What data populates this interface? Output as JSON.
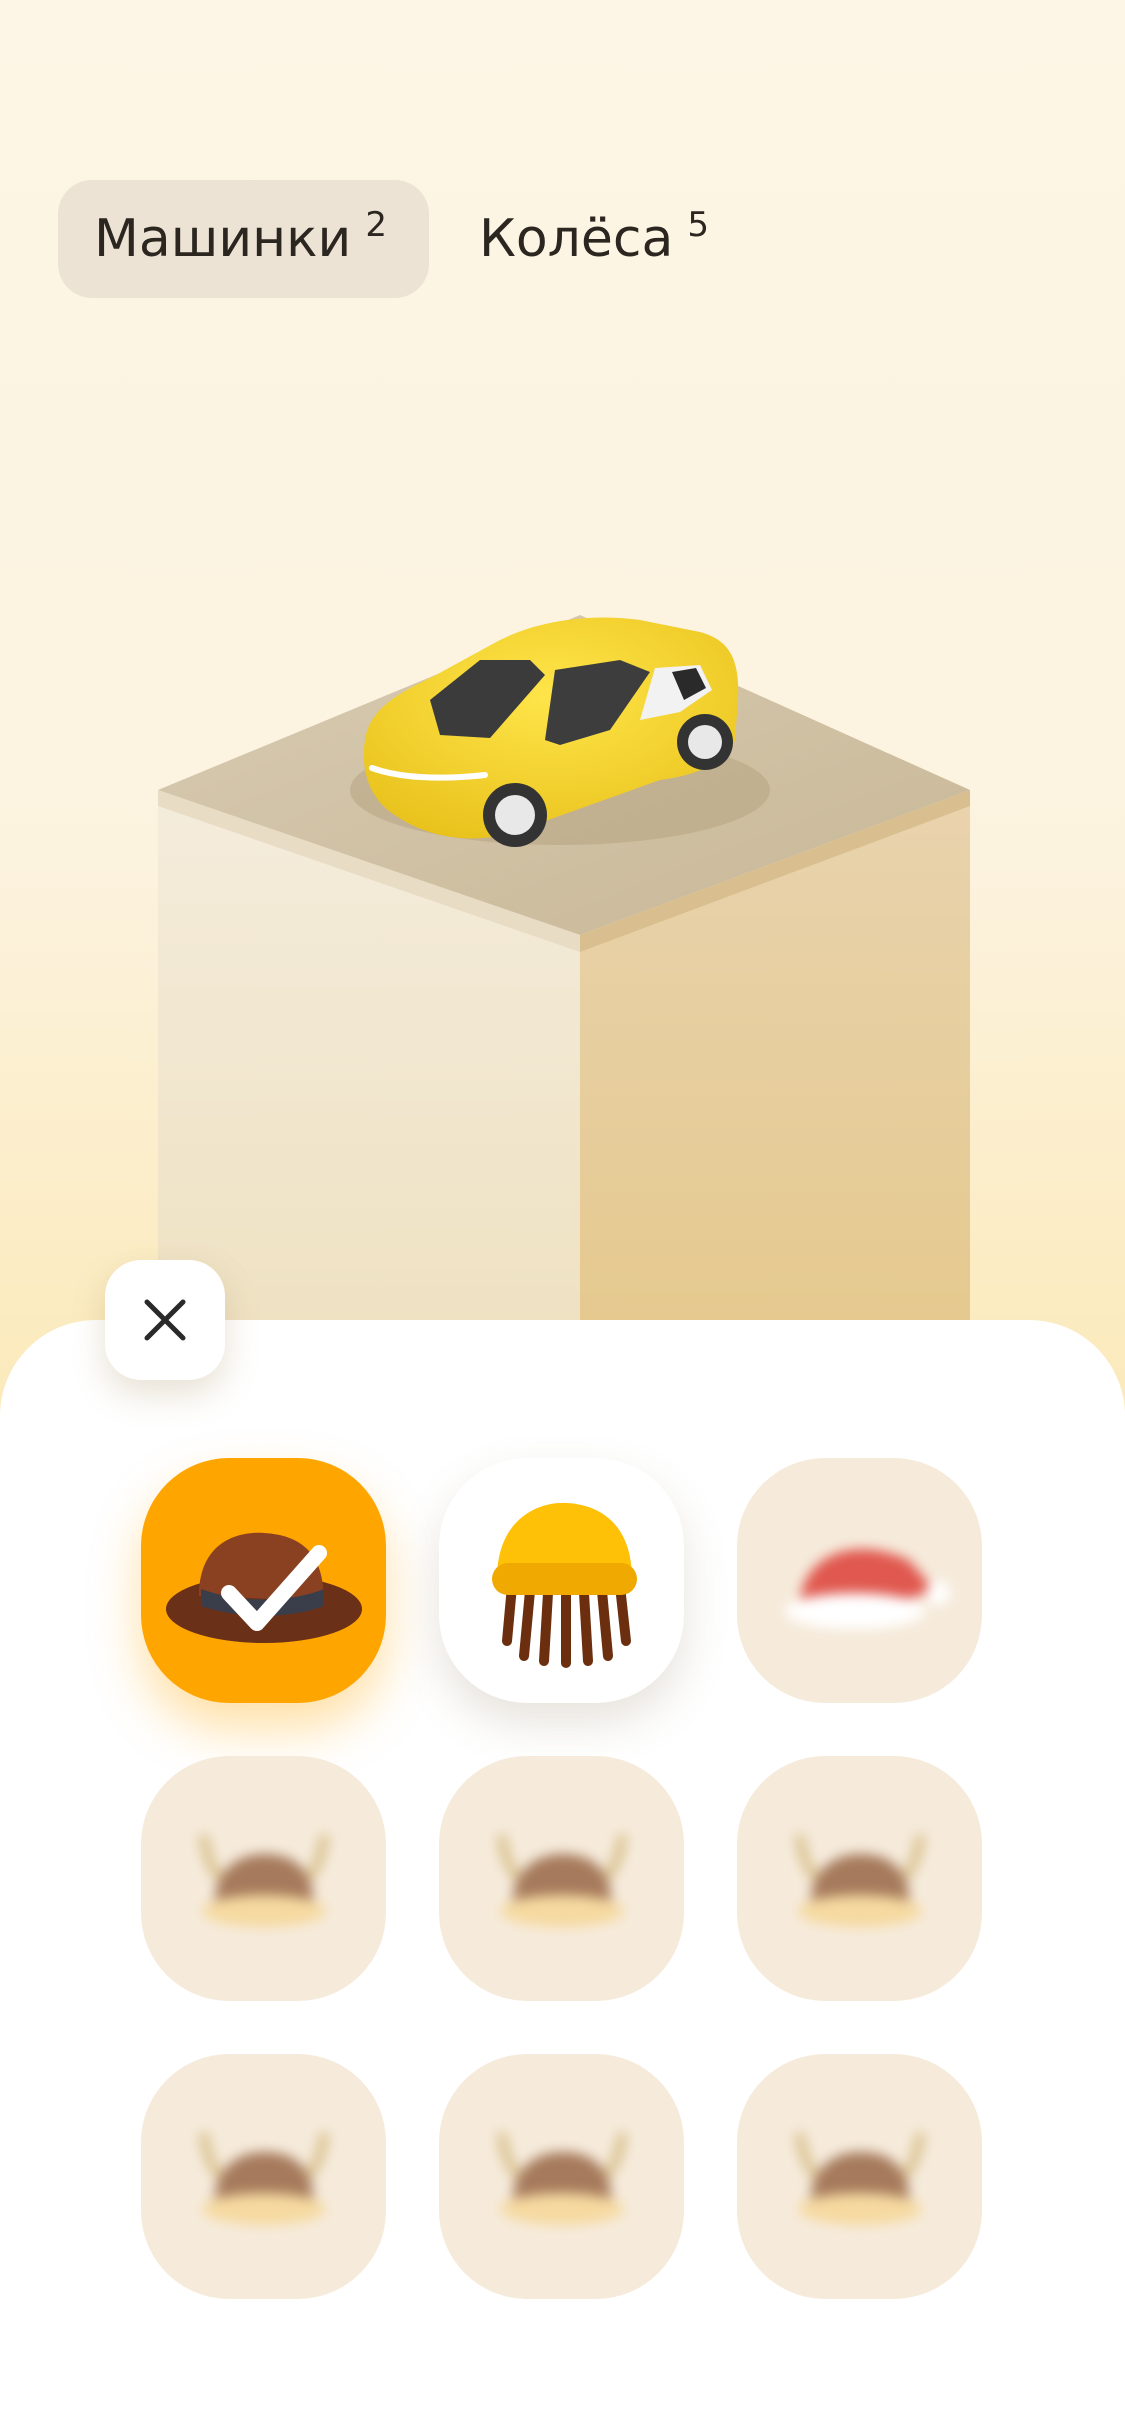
{
  "tabs": [
    {
      "label": "Машинки",
      "count": "2",
      "active": true
    },
    {
      "label": "Колёса",
      "count": "5",
      "active": false
    }
  ],
  "scene": {
    "car_color": "#f2d22c",
    "pedestal_top_color": "#cfc0a4"
  },
  "close_icon": "close-icon",
  "items": [
    {
      "name": "fedora-hat",
      "state": "selected",
      "icon": "fedora-icon"
    },
    {
      "name": "beanie-dreadlocks",
      "state": "owned",
      "icon": "beanie-icon"
    },
    {
      "name": "santa-hat",
      "state": "locked",
      "icon": "santa-hat-icon"
    },
    {
      "name": "viking-helmet",
      "state": "locked",
      "icon": "viking-helmet-icon"
    },
    {
      "name": "viking-helmet",
      "state": "locked",
      "icon": "viking-helmet-icon"
    },
    {
      "name": "viking-helmet",
      "state": "locked",
      "icon": "viking-helmet-icon"
    },
    {
      "name": "viking-helmet",
      "state": "locked",
      "icon": "viking-helmet-icon"
    },
    {
      "name": "viking-helmet",
      "state": "locked",
      "icon": "viking-helmet-icon"
    },
    {
      "name": "viking-helmet",
      "state": "locked",
      "icon": "viking-helmet-icon"
    }
  ],
  "colors": {
    "accent": "#ffa500",
    "locked_tile": "#f6ebdb"
  }
}
